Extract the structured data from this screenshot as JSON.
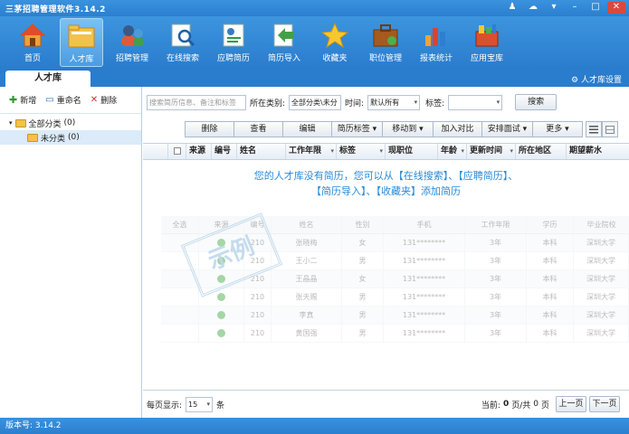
{
  "window": {
    "title": "三茅招聘管理软件3.14.2"
  },
  "toolbar": {
    "items": [
      {
        "label": "首页"
      },
      {
        "label": "人才库"
      },
      {
        "label": "招聘管理"
      },
      {
        "label": "在线搜索"
      },
      {
        "label": "应聘简历"
      },
      {
        "label": "简历导入"
      },
      {
        "label": "收藏夹"
      },
      {
        "label": "职位管理"
      },
      {
        "label": "报表统计"
      },
      {
        "label": "应用宝库"
      }
    ]
  },
  "tabs": {
    "active": "人才库",
    "settings": "人才库设置"
  },
  "sidebar": {
    "add": "新增",
    "rename": "重命名",
    "delete": "删除",
    "tree": [
      {
        "label": "全部分类",
        "count": "(0)"
      },
      {
        "label": "未分类",
        "count": "(0)"
      }
    ]
  },
  "search": {
    "placeholder": "搜索简历信息、备注和标签",
    "category_label": "所在类别:",
    "category_value": "全部分类\\未分",
    "time_label": "时间:",
    "time_value": "默认所有",
    "tag_label": "标签:",
    "tag_value": "",
    "button": "搜索"
  },
  "actions": [
    "删除",
    "查看",
    "编辑",
    "简历标签",
    "移动到",
    "加入对比",
    "安排面试",
    "更多"
  ],
  "grid": {
    "columns": [
      "来源",
      "编号",
      "姓名",
      "工作年限",
      "标签",
      "现职位",
      "年龄",
      "更新时间",
      "所在地区",
      "期望薪水"
    ],
    "empty_line1": "您的人才库没有简历，您可以从【在线搜索】、【应聘简历】、",
    "empty_line2": "【简历导入】、【收藏夹】添加简历"
  },
  "sample": {
    "stamp": "示例",
    "columns": [
      "全选",
      "来源",
      "编号",
      "姓名",
      "性别",
      "手机",
      "工作年限",
      "学历",
      "毕业院校"
    ],
    "rows": [
      {
        "num": "210",
        "name": "张晓梅",
        "gender": "女",
        "phone": "131********",
        "years": "3年",
        "edu": "本科",
        "school": "深圳大学"
      },
      {
        "num": "210",
        "name": "王小二",
        "gender": "男",
        "phone": "131********",
        "years": "3年",
        "edu": "本科",
        "school": "深圳大学"
      },
      {
        "num": "210",
        "name": "王晶晶",
        "gender": "女",
        "phone": "131********",
        "years": "3年",
        "edu": "本科",
        "school": "深圳大学"
      },
      {
        "num": "210",
        "name": "张天赐",
        "gender": "男",
        "phone": "131********",
        "years": "3年",
        "edu": "本科",
        "school": "深圳大学"
      },
      {
        "num": "210",
        "name": "李真",
        "gender": "男",
        "phone": "131********",
        "years": "3年",
        "edu": "本科",
        "school": "深圳大学"
      },
      {
        "num": "210",
        "name": "黄国强",
        "gender": "男",
        "phone": "131********",
        "years": "3年",
        "edu": "本科",
        "school": "深圳大学"
      }
    ]
  },
  "pager": {
    "per_page_label": "每页显示:",
    "per_page": "15",
    "unit": "条",
    "current_label": "当前:",
    "current": "0",
    "page_sep": "页/共",
    "total": "0",
    "page_unit": "页",
    "prev": "上一页",
    "next": "下一页"
  },
  "status": {
    "version": "版本号: 3.14.2"
  }
}
